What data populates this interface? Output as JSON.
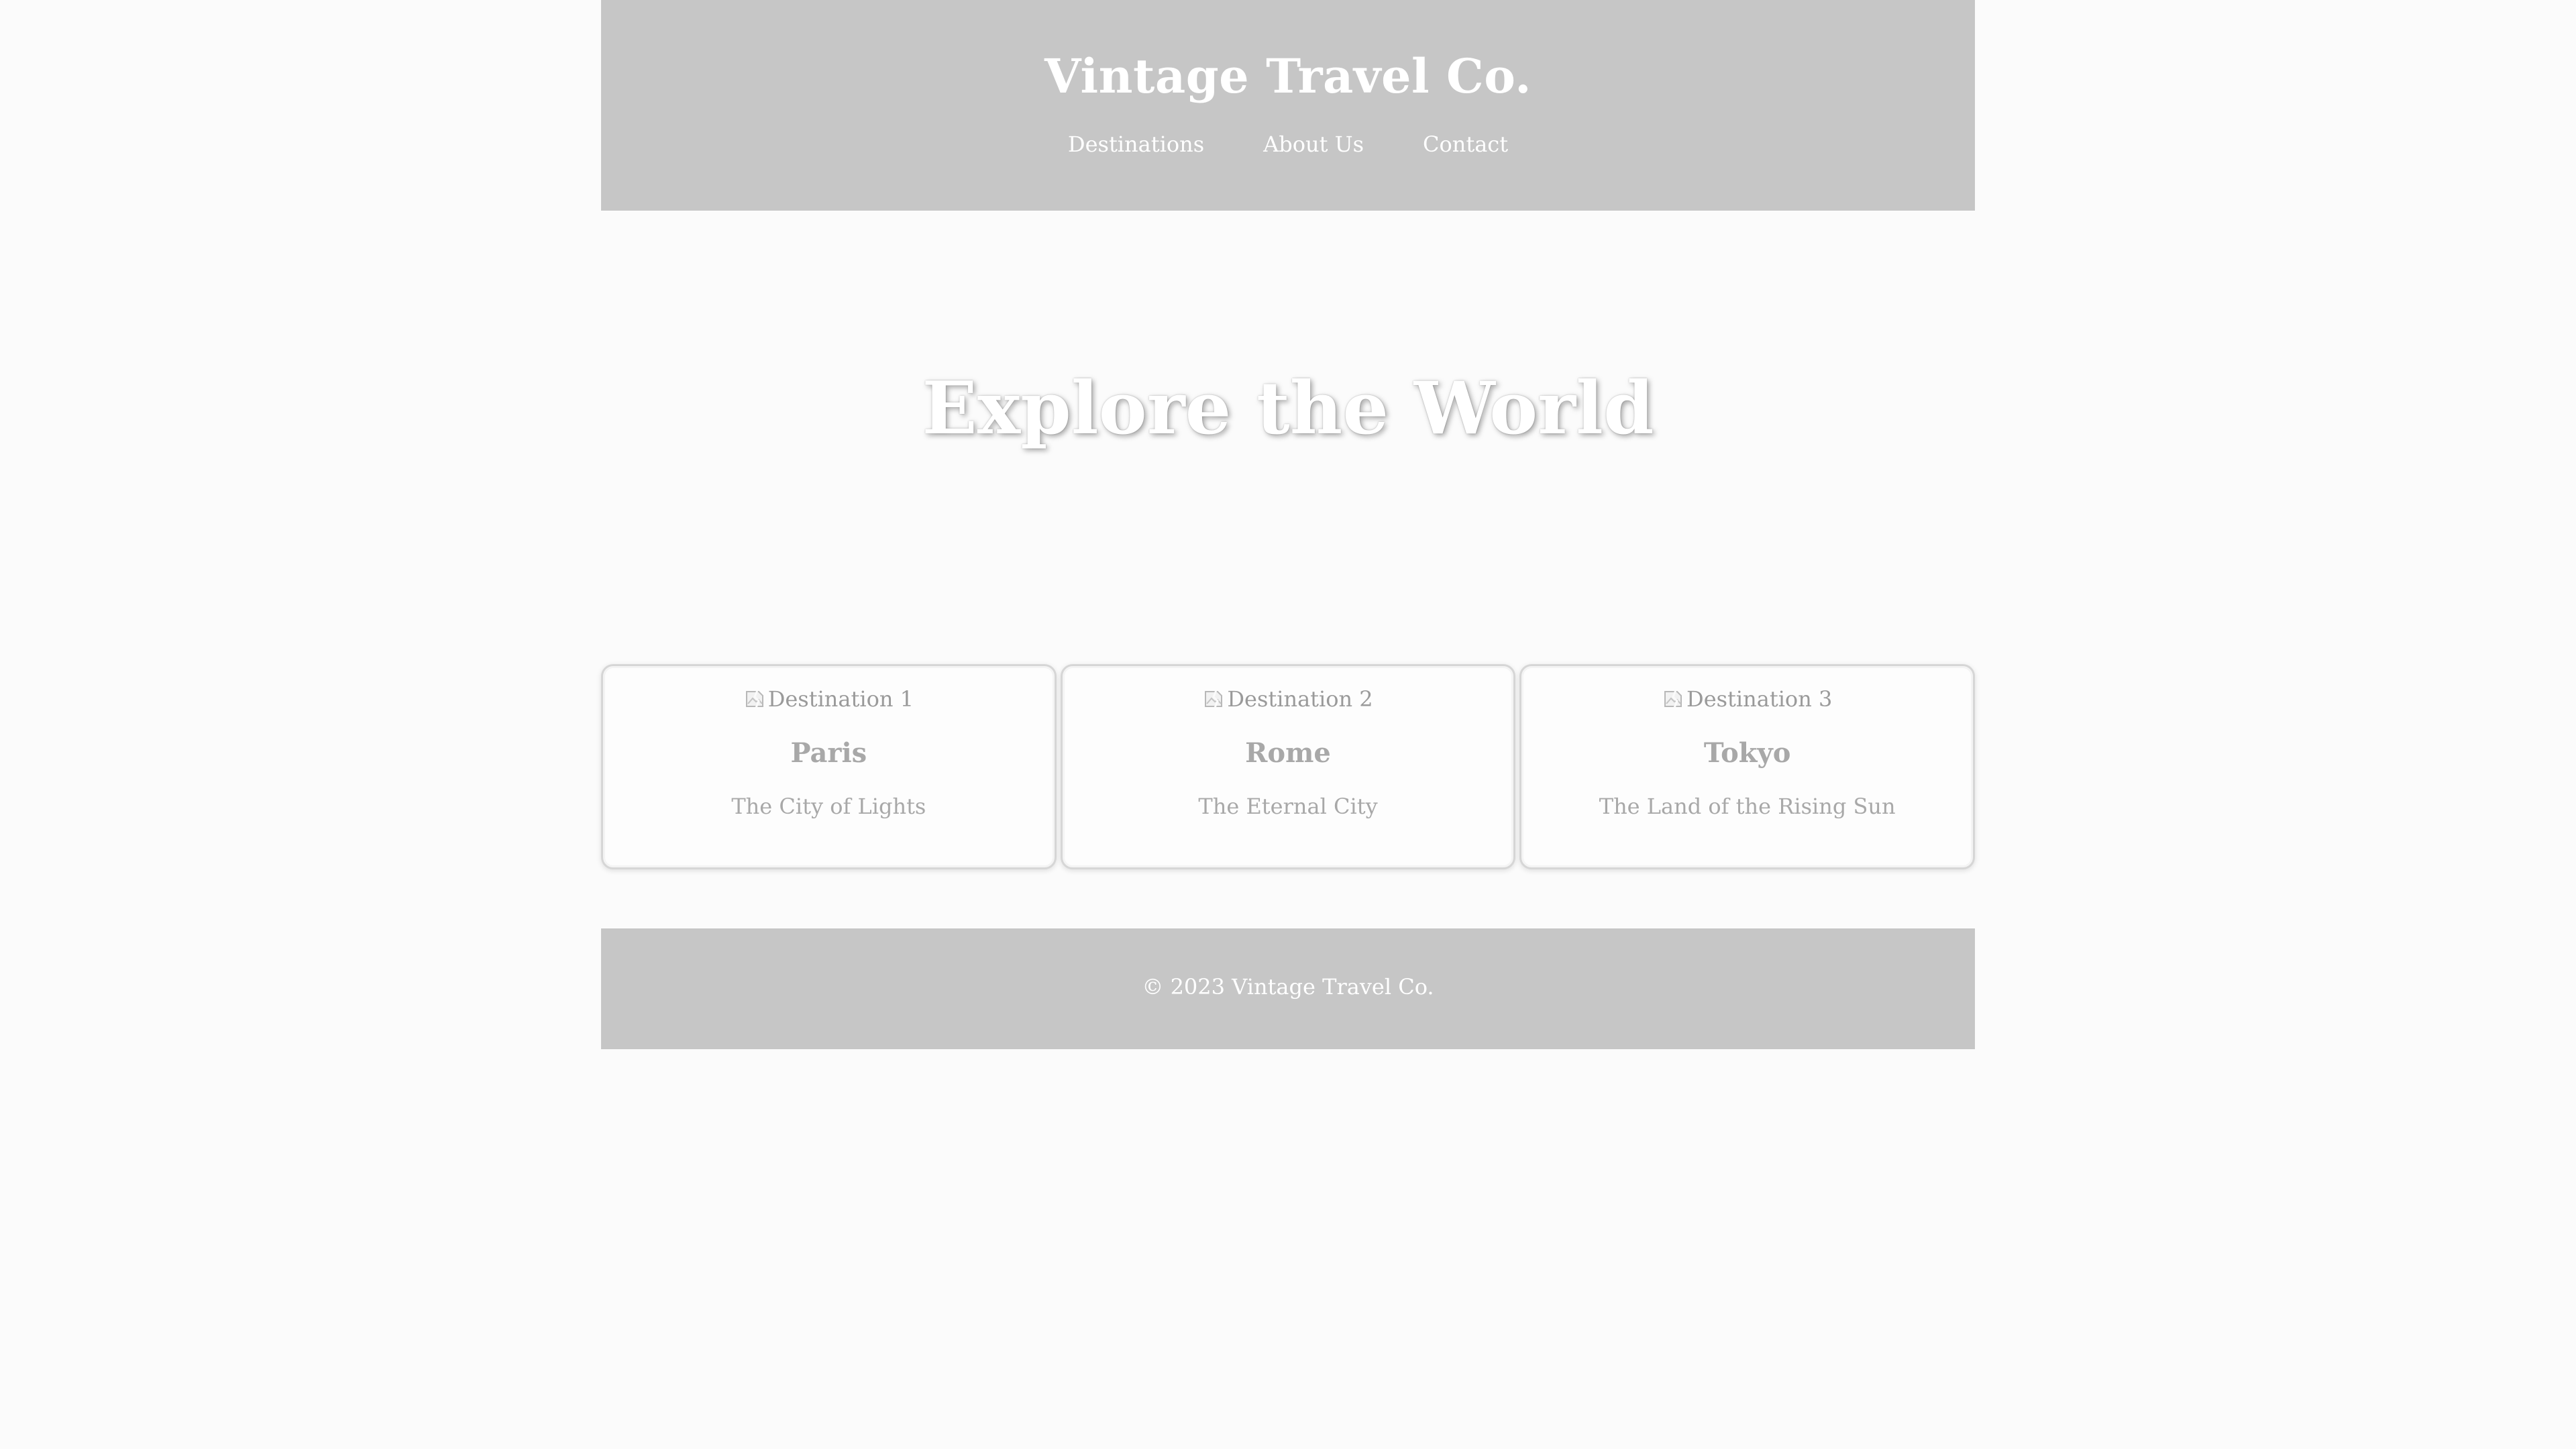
{
  "header": {
    "title": "Vintage Travel Co.",
    "nav": [
      {
        "label": "Destinations"
      },
      {
        "label": "About Us"
      },
      {
        "label": "Contact"
      }
    ]
  },
  "hero": {
    "title": "Explore the World"
  },
  "destinations": [
    {
      "image_alt": "Destination 1",
      "name": "Paris",
      "tagline": "The City of Lights"
    },
    {
      "image_alt": "Destination 2",
      "name": "Rome",
      "tagline": "The Eternal City"
    },
    {
      "image_alt": "Destination 3",
      "name": "Tokyo",
      "tagline": "The Land of the Rising Sun"
    }
  ],
  "footer": {
    "copyright": "© 2023 Vintage Travel Co."
  },
  "colors": {
    "header_bg": "#c6c6c6",
    "page_bg": "#fbfbfb",
    "text_light": "#ffffff",
    "text_muted": "#a8a8a8"
  }
}
